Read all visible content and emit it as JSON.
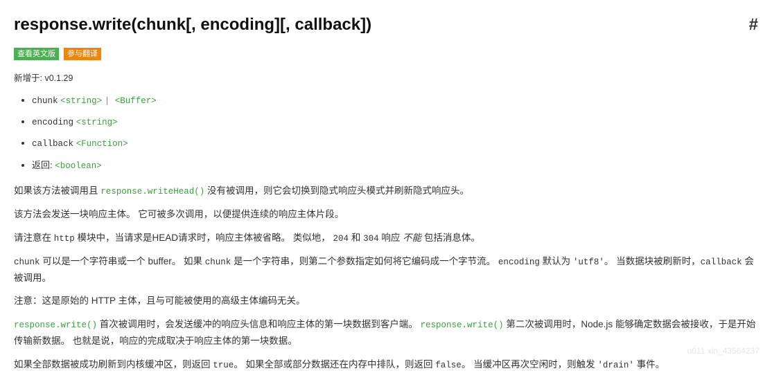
{
  "heading": {
    "text": "response.write(chunk[, encoding][, callback])",
    "anchor": "#"
  },
  "badges": {
    "view_en": "查看英文版",
    "translate": "参与翻译"
  },
  "added_in": "新增于: v0.1.29",
  "params": {
    "chunk_name": "chunk",
    "chunk_type1": "<string>",
    "chunk_sep": " | ",
    "chunk_type2": "<Buffer>",
    "encoding_name": "encoding",
    "encoding_type": "<string>",
    "callback_name": "callback",
    "callback_type": "<Function>",
    "return_label": "返回: ",
    "return_type": "<boolean>"
  },
  "body": {
    "p1_a": "如果该方法被调用且 ",
    "p1_code": "response.writeHead()",
    "p1_b": " 没有被调用，则它会切换到隐式响应头模式并刷新隐式响应头。",
    "p2": "该方法会发送一块响应主体。 它可被多次调用，以便提供连续的响应主体片段。",
    "p3_a": "请注意在 ",
    "p3_http": "http",
    "p3_b": " 模块中，当请求是HEAD请求时，响应主体被省略。 类似地， ",
    "p3_c204": "204",
    "p3_and": " 和 ",
    "p3_c304": "304",
    "p3_c": " 响应 ",
    "p3_cannot": "不能",
    "p3_d": " 包括消息体。",
    "p4_chunk1": "chunk",
    "p4_a": " 可以是一个字符串或一个 buffer。 如果 ",
    "p4_chunk2": "chunk",
    "p4_b": " 是一个字符串，则第二个参数指定如何将它编码成一个字节流。 ",
    "p4_enc": "encoding",
    "p4_c": " 默认为 ",
    "p4_utf8": "'utf8'",
    "p4_d": "。 当数据块被刷新时，",
    "p4_cb": "callback",
    "p4_e": " 会被调用。",
    "p5": "注意：这是原始的 HTTP 主体，且与可能被使用的高级主体编码无关。",
    "p6_rw1": "response.write()",
    "p6_a": " 首次被调用时，会发送缓冲的响应头信息和响应主体的第一块数据到客户端。 ",
    "p6_rw2": "response.write()",
    "p6_b": " 第二次被调用时，Node.js 能够确定数据会被接收，于是开始传输新数据。 也就是说，响应的完成取决于响应主体的第一块数据。",
    "p7_a": "如果全部数据被成功刷新到内核缓冲区，则返回 ",
    "p7_true": "true",
    "p7_b": "。 如果全部或部分数据还在内存中排队，则返回 ",
    "p7_false": "false",
    "p7_c": "。 当缓冲区再次空闲时，则触发 ",
    "p7_drain": "'drain'",
    "p7_d": " 事件。"
  },
  "watermark": "u011 xin_43564237"
}
